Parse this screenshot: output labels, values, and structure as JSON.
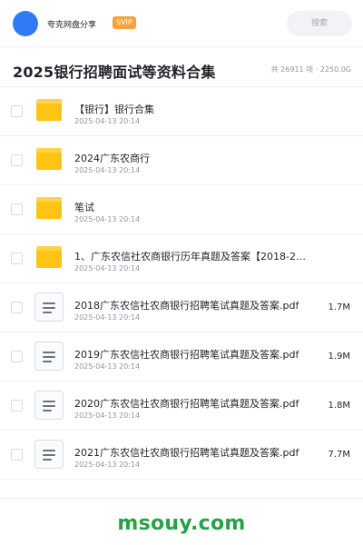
{
  "header": {
    "user_name": "夸克网盘分享",
    "badge": "SVIP",
    "search_placeholder": "搜索"
  },
  "page": {
    "title": "2025银行招聘面试等资料合集",
    "meta": "共 26911 项 · 2250.0G"
  },
  "files": [
    {
      "name": "【银行】银行合集",
      "date": "2025-04-13 20:14",
      "size": "",
      "type": "folder"
    },
    {
      "name": "2024广东农商行",
      "date": "2025-04-13 20:14",
      "size": "",
      "type": "folder"
    },
    {
      "name": "笔试",
      "date": "2025-04-13 20:14",
      "size": "",
      "type": "folder"
    },
    {
      "name": "1、广东农信社农商银行历年真题及答案【2018-2…",
      "date": "2025-04-13 20:14",
      "size": "",
      "type": "folder"
    },
    {
      "name": "2018广东农信社农商银行招聘笔试真题及答案.pdf",
      "date": "2025-04-13 20:14",
      "size": "1.7M",
      "type": "file"
    },
    {
      "name": "2019广东农信社农商银行招聘笔试真题及答案.pdf",
      "date": "2025-04-13 20:14",
      "size": "1.9M",
      "type": "file"
    },
    {
      "name": "2020广东农信社农商银行招聘笔试真题及答案.pdf",
      "date": "2025-04-13 20:14",
      "size": "1.8M",
      "type": "file"
    },
    {
      "name": "2021广东农信社农商银行招聘笔试真题及答案.pdf",
      "date": "2025-04-13 20:14",
      "size": "7.7M",
      "type": "file"
    }
  ],
  "watermark": "msouy.com",
  "colors": {
    "avatar": "#2f7bf5",
    "badge": "#f7a33a",
    "folder": "#ffc414",
    "watermark": "#25a243"
  }
}
